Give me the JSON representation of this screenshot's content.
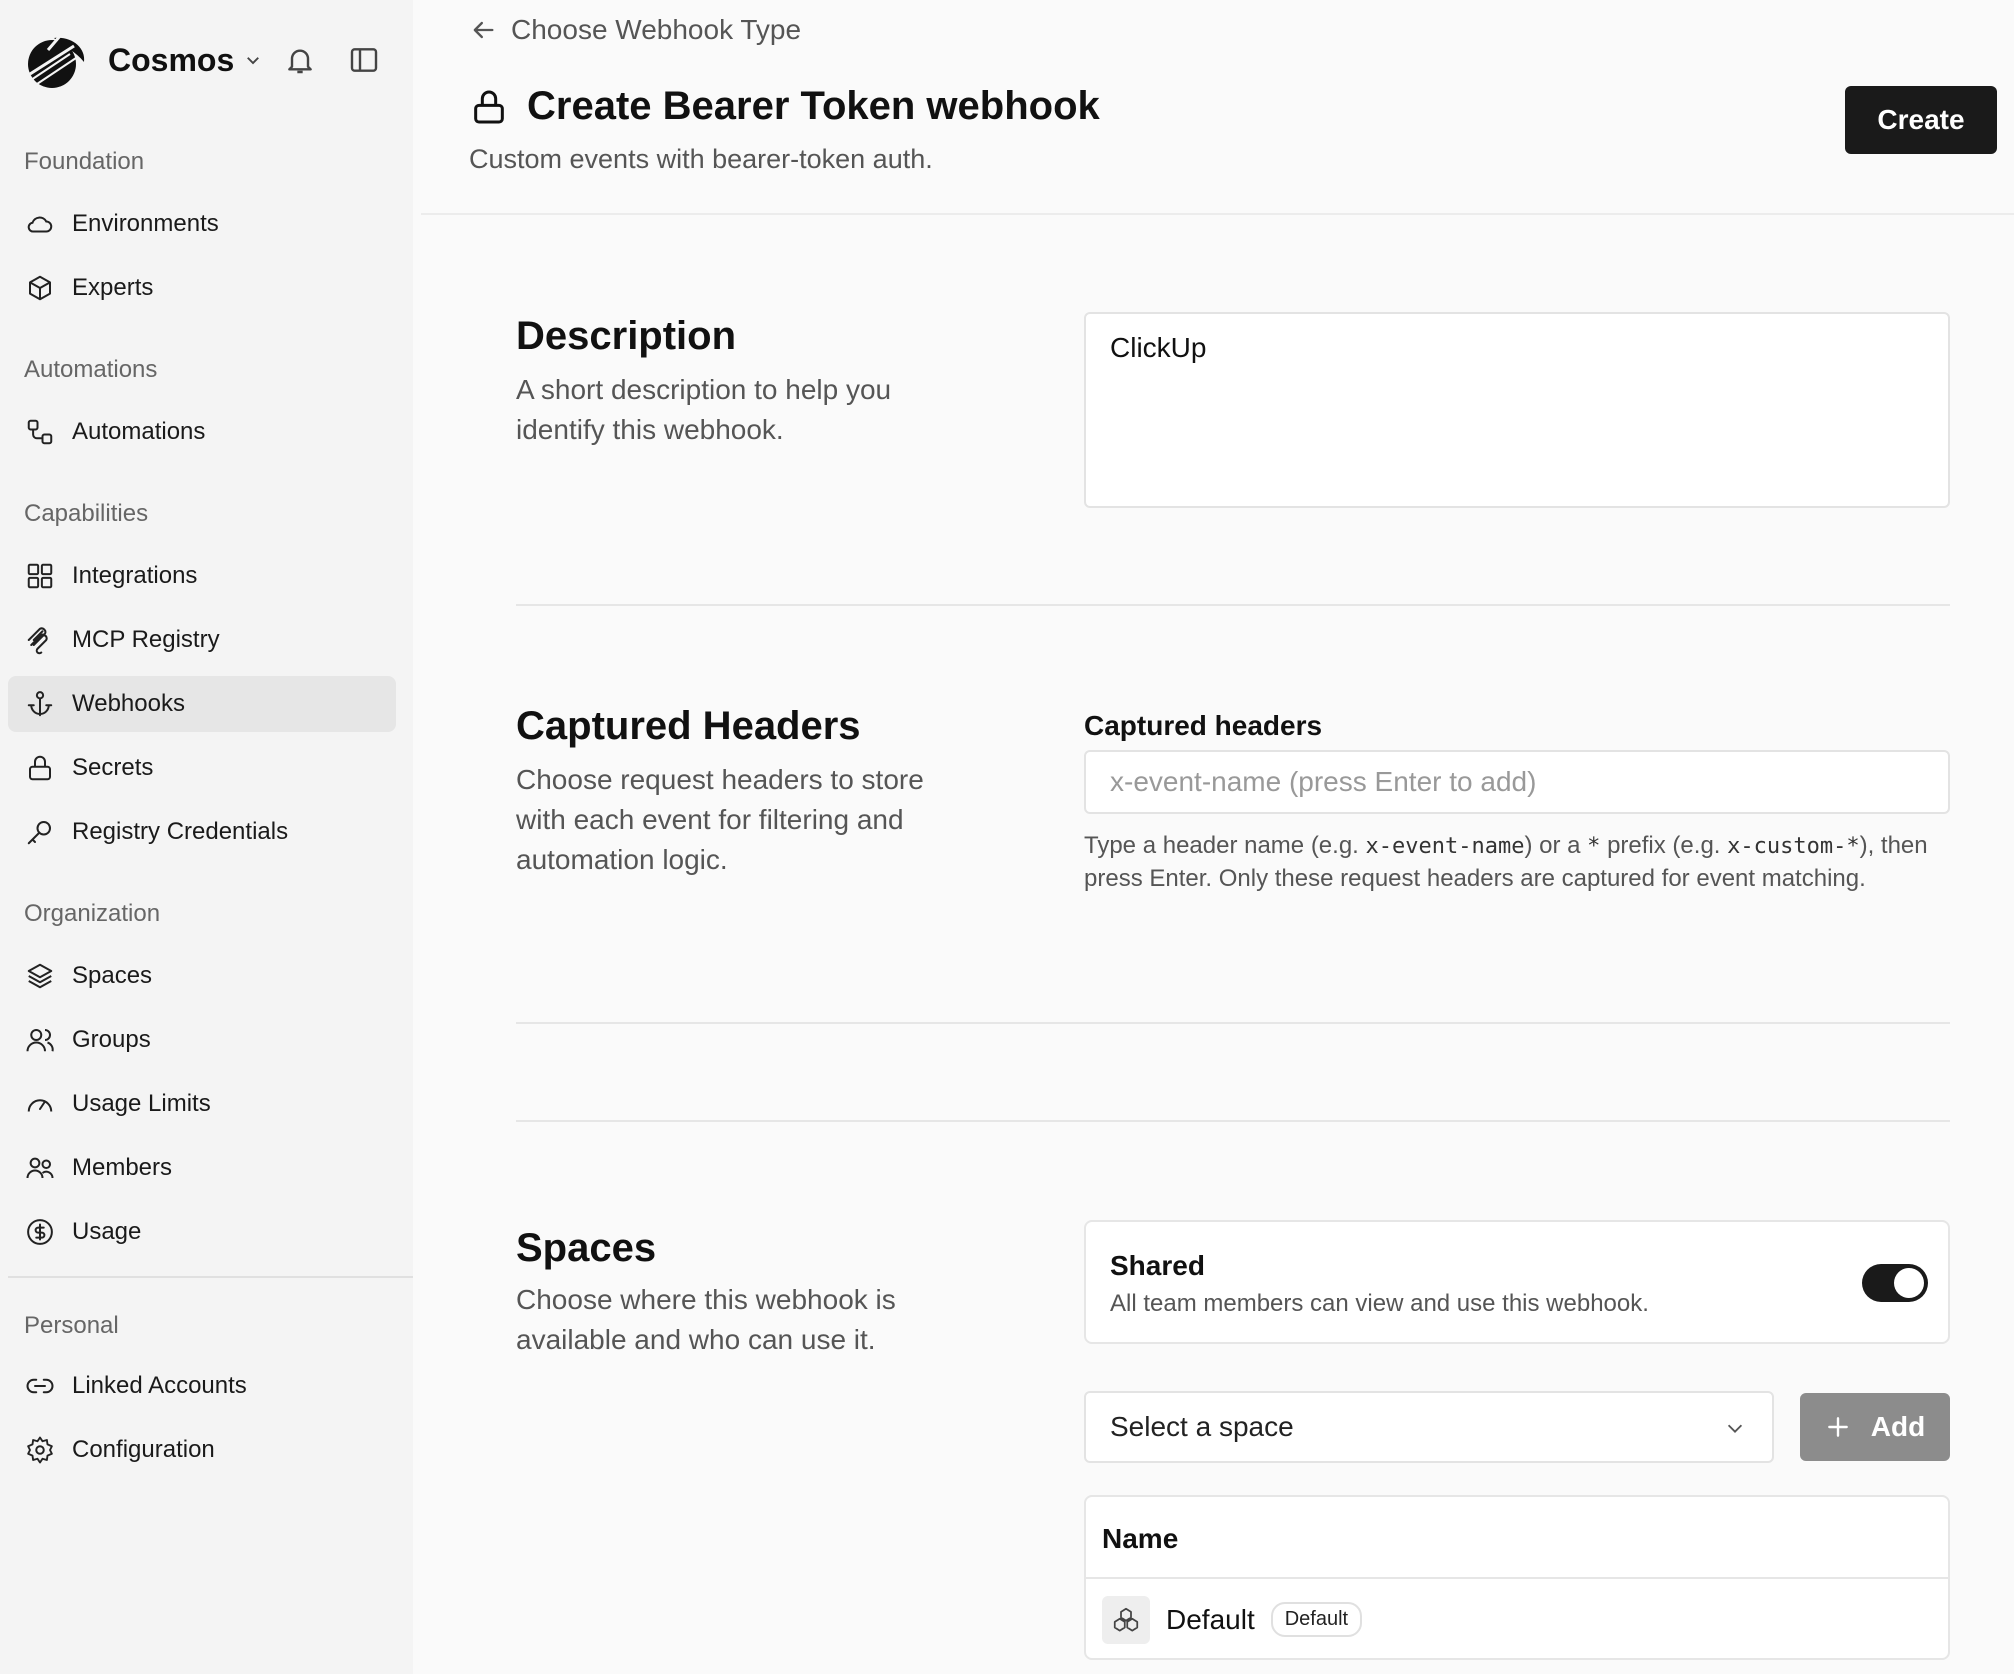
{
  "app": {
    "name": "Cosmos"
  },
  "sidebar": {
    "sections": [
      {
        "label": "Foundation",
        "items": [
          {
            "label": "Environments",
            "icon": "cloud-icon"
          },
          {
            "label": "Experts",
            "icon": "cube-icon"
          }
        ]
      },
      {
        "label": "Automations",
        "items": [
          {
            "label": "Automations",
            "icon": "workflow-icon"
          }
        ]
      },
      {
        "label": "Capabilities",
        "items": [
          {
            "label": "Integrations",
            "icon": "grid-icon"
          },
          {
            "label": "MCP Registry",
            "icon": "mcp-icon"
          },
          {
            "label": "Webhooks",
            "icon": "anchor-icon",
            "active": true
          },
          {
            "label": "Secrets",
            "icon": "lock-icon"
          },
          {
            "label": "Registry Credentials",
            "icon": "key-icon"
          }
        ]
      },
      {
        "label": "Organization",
        "items": [
          {
            "label": "Spaces",
            "icon": "layers-icon"
          },
          {
            "label": "Groups",
            "icon": "users-icon"
          },
          {
            "label": "Usage Limits",
            "icon": "gauge-icon"
          },
          {
            "label": "Members",
            "icon": "members-icon"
          },
          {
            "label": "Usage",
            "icon": "dollar-icon"
          }
        ]
      },
      {
        "label": "Personal",
        "items": [
          {
            "label": "Linked Accounts",
            "icon": "link-icon"
          },
          {
            "label": "Configuration",
            "icon": "gear-icon"
          }
        ]
      }
    ]
  },
  "header": {
    "back_label": "Choose Webhook Type",
    "title": "Create Bearer Token webhook",
    "subtitle": "Custom events with bearer-token auth.",
    "create_label": "Create"
  },
  "description_section": {
    "title": "Description",
    "desc": "A short description to help you identify this webhook.",
    "value": "ClickUp"
  },
  "headers_section": {
    "title": "Captured Headers",
    "desc": "Choose request headers to store with each event for filtering and automation logic.",
    "field_label": "Captured headers",
    "placeholder": "x-event-name (press Enter to add)",
    "help_1": "Type a header name (e.g. ",
    "help_code_1": "x-event-name",
    "help_2": ") or a ",
    "help_code_2": "*",
    "help_3": " prefix (e.g. ",
    "help_code_3": "x-custom-*",
    "help_4": "), then press Enter. Only these request headers are captured for event matching."
  },
  "spaces_section": {
    "title": "Spaces",
    "desc": "Choose where this webhook is available and who can use it.",
    "shared_title": "Shared",
    "shared_desc": "All team members can view and use this webhook.",
    "shared_on": true,
    "select_value": "Select a space",
    "add_label": "Add",
    "table_header": "Name",
    "rows": [
      {
        "name": "Default",
        "badge": "Default"
      }
    ]
  }
}
